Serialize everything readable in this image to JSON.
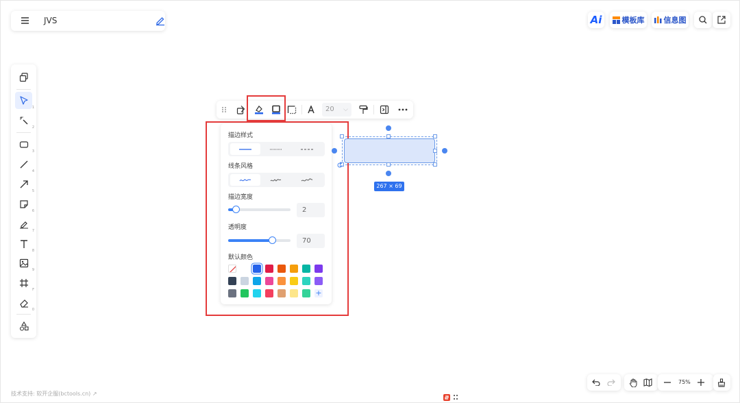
{
  "doc": {
    "title": "JVS"
  },
  "top_right": {
    "ai_label": "Ai",
    "templates_label": "模板库",
    "infographic_label": "信息图"
  },
  "left_tools": [
    {
      "name": "layers",
      "key": ""
    },
    {
      "name": "select",
      "key": "1"
    },
    {
      "name": "laser",
      "key": "2"
    },
    {
      "name": "rectangle",
      "key": "3"
    },
    {
      "name": "line",
      "key": "4"
    },
    {
      "name": "arrow",
      "key": "5"
    },
    {
      "name": "sticky-note",
      "key": "6"
    },
    {
      "name": "pen",
      "key": "7"
    },
    {
      "name": "text",
      "key": "8"
    },
    {
      "name": "image",
      "key": "9"
    },
    {
      "name": "frame",
      "key": "F"
    },
    {
      "name": "eraser",
      "key": "0"
    },
    {
      "name": "shapes",
      "key": ""
    }
  ],
  "floating_toolbar": {
    "font_size": "20"
  },
  "style_panel": {
    "stroke_style_label": "描边样式",
    "line_style_label": "线条风格",
    "stroke_width_label": "描边宽度",
    "stroke_width_value": "2",
    "stroke_width_fraction": 0.12,
    "opacity_label": "透明度",
    "opacity_value": "70",
    "opacity_fraction": 0.7,
    "default_colors_label": "默认颜色",
    "colors": [
      [
        "none",
        "#ffffff",
        "#2563eb",
        "#e11d48",
        "#ea580c",
        "#f59e0b",
        "#06b6a4",
        "#7c3aed"
      ],
      [
        "#334155",
        "#cbd5e1",
        "#0ea5e9",
        "#ec4899",
        "#fb923c",
        "#facc15",
        "#2dd4bf",
        "#8b5cf6"
      ],
      [
        "#6b7280",
        "#22c55e",
        "#22d3ee",
        "#f43f5e",
        "#e0a070",
        "#fde68a",
        "#34d399",
        "add"
      ]
    ],
    "selected_color": "#2563eb"
  },
  "canvas": {
    "shape_size_label": "267 × 69"
  },
  "bottom": {
    "zoom_label": "75%"
  },
  "footer": {
    "text": "技术支持: 软开企服(bctools.cn) ↗"
  },
  "accent": "#3b82f6"
}
